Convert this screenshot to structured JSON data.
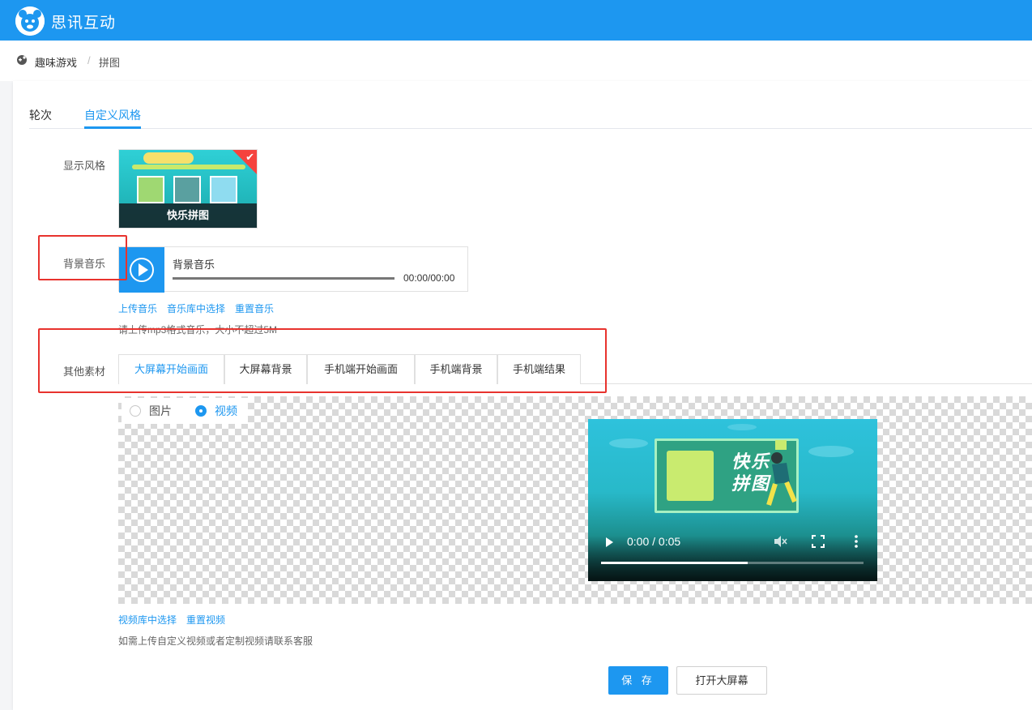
{
  "header": {
    "brand": "思讯互动",
    "logo_icon": "bear-logo-icon",
    "color": "#1d97f0"
  },
  "breadcrumb": {
    "icon": "game-pad-icon",
    "items": [
      "趣味游戏",
      "拼图"
    ],
    "separator": "/"
  },
  "tabs": [
    {
      "label": "轮次",
      "active": false
    },
    {
      "label": "自定义风格",
      "active": true
    }
  ],
  "form": {
    "display_style_label": "显示风格",
    "style_card": {
      "caption": "快乐拼图",
      "selected": true
    },
    "bg_music_label": "背景音乐",
    "music": {
      "title": "背景音乐",
      "time": "00:00/00:00"
    },
    "music_links": [
      "上传音乐",
      "音乐库中选择",
      "重置音乐"
    ],
    "music_hint": "请上传mp3格式音乐，大小不超过5M",
    "other_material_label": "其他素材",
    "material_tabs": [
      {
        "label": "大屏幕开始画面",
        "active": true
      },
      {
        "label": "大屏幕背景",
        "active": false
      },
      {
        "label": "手机端开始画面",
        "active": false
      },
      {
        "label": "手机端背景",
        "active": false
      },
      {
        "label": "手机端结果",
        "active": false
      }
    ],
    "media_type": {
      "options": [
        "图片",
        "视频"
      ],
      "selected": "视频"
    },
    "video": {
      "title_line1": "快乐",
      "title_line2": "拼图",
      "time": "0:00 / 0:05",
      "progress": 0.56
    },
    "video_links": [
      "视频库中选择",
      "重置视频"
    ],
    "video_hint": "如需上传自定义视频或者定制视频请联系客服"
  },
  "buttons": {
    "save": "保 存",
    "open_screen": "打开大屏幕"
  },
  "annotation_color": "#e8332e"
}
